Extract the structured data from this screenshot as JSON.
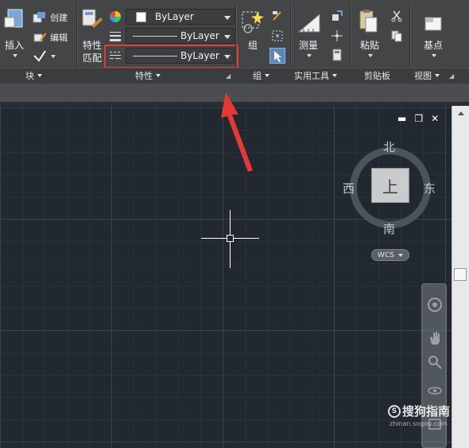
{
  "ribbon": {
    "block_panel": {
      "insert_label": "插入",
      "create_label": "创建",
      "edit_label": "编辑",
      "panel_label": "块"
    },
    "properties_panel": {
      "match_label_line1": "特性",
      "match_label_line2": "匹配",
      "color_value": "ByLayer",
      "lineweight_value": "ByLayer",
      "linetype_value": "ByLayer",
      "panel_label": "特性"
    },
    "group_panel": {
      "group_label": "组",
      "panel_label": "组"
    },
    "utilities_panel": {
      "measure_label": "测量",
      "panel_label": "实用工具"
    },
    "clipboard_panel": {
      "paste_label": "粘贴",
      "panel_label": "剪贴板"
    },
    "view_panel": {
      "base_label": "基点",
      "panel_label": "视图"
    }
  },
  "window_controls": {
    "minimize": "▬",
    "restore": "❐",
    "close": "✕"
  },
  "viewcube": {
    "north": "北",
    "south": "南",
    "east": "东",
    "west": "西",
    "top_face": "上",
    "wcs_label": "WCS"
  },
  "watermark": {
    "brand": "搜狗指南",
    "site": "zhinan.sogou.com"
  },
  "colors": {
    "annotation_red": "#e53935",
    "canvas_bg": "#212830",
    "ribbon_bg": "#434547"
  }
}
